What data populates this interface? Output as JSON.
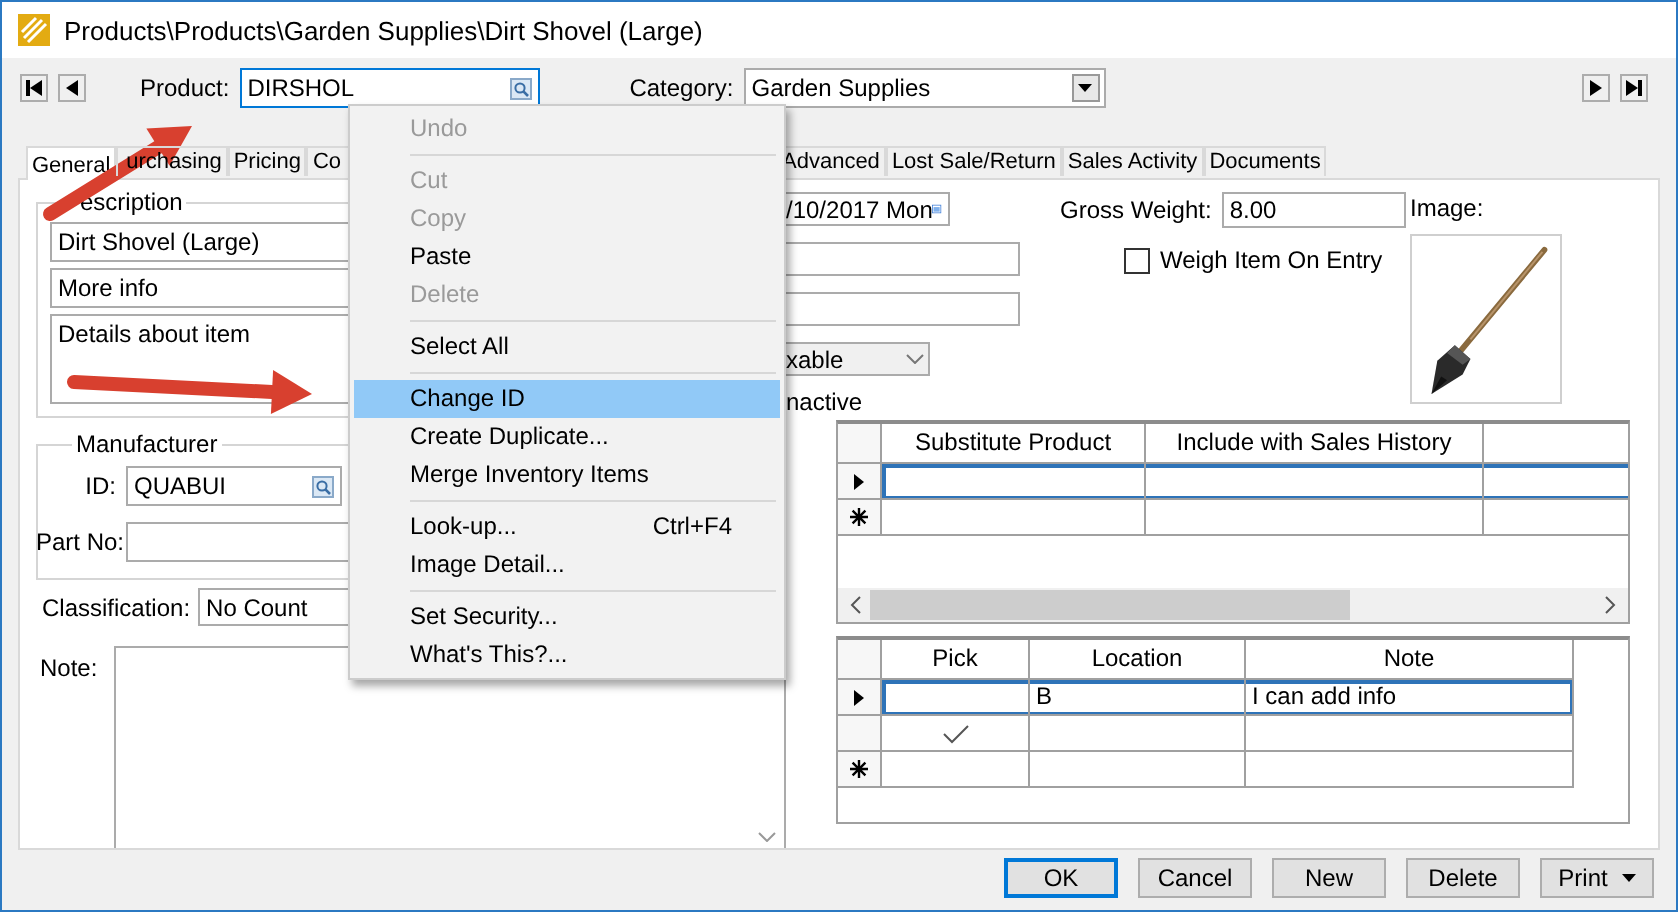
{
  "window": {
    "title": "Products\\Products\\Garden Supplies\\Dirt Shovel (Large)"
  },
  "header": {
    "product_label": "Product:",
    "product_value": "DIRSHOL",
    "category_label": "Category:",
    "category_value": "Garden Supplies"
  },
  "tabs": [
    {
      "label": "General",
      "selected": true
    },
    {
      "label": "urchasing",
      "selected": false
    },
    {
      "label": "Pricing",
      "selected": false
    },
    {
      "label": "Co",
      "selected": false
    },
    {
      "label": "Advanced",
      "selected": false
    },
    {
      "label": "Lost Sale/Return",
      "selected": false
    },
    {
      "label": "Sales Activity",
      "selected": false
    },
    {
      "label": "Documents",
      "selected": false
    }
  ],
  "general": {
    "description_legend": "escription",
    "description_lines": [
      "Dirt Shovel (Large)",
      "More info"
    ],
    "details": "Details about item",
    "manufacturer_legend": "Manufacturer",
    "id_label": "ID:",
    "id_value": "QUABUI",
    "part_no_label": "Part No:",
    "classification_label": "Classification:",
    "classification_value": "No Count",
    "note_label": "Note:",
    "date_value": "/10/2017 Mon",
    "tax_value": "xable",
    "inactive_label": "nactive",
    "gross_weight_label": "Gross Weight:",
    "gross_weight_value": "8.00",
    "weigh_item": {
      "label": "Weigh Item On Entry",
      "checked": false
    },
    "image_label": "Image:"
  },
  "substitutes_grid": {
    "columns": [
      "Substitute Product",
      "Include with Sales History"
    ],
    "rows": [
      {
        "kind": "current",
        "selected": true
      },
      {
        "kind": "new",
        "selected": false
      }
    ]
  },
  "locations_grid": {
    "columns": [
      "Pick",
      "Location",
      "Note"
    ],
    "rows": [
      {
        "kind": "current",
        "selected": true,
        "pick": false,
        "location": "B",
        "note": "I can add info"
      },
      {
        "kind": "record",
        "selected": false,
        "pick": true
      },
      {
        "kind": "new",
        "selected": false,
        "pick": false
      }
    ]
  },
  "context_menu": [
    {
      "kind": "item",
      "label": "Undo",
      "disabled": true,
      "selected": false
    },
    {
      "kind": "separator"
    },
    {
      "kind": "item",
      "label": "Cut",
      "disabled": true,
      "selected": false
    },
    {
      "kind": "item",
      "label": "Copy",
      "disabled": true,
      "selected": false
    },
    {
      "kind": "item",
      "label": "Paste",
      "disabled": false,
      "selected": false
    },
    {
      "kind": "item",
      "label": "Delete",
      "disabled": true,
      "selected": false
    },
    {
      "kind": "separator"
    },
    {
      "kind": "item",
      "label": "Select All",
      "disabled": false,
      "selected": false
    },
    {
      "kind": "separator"
    },
    {
      "kind": "item",
      "label": "Change ID",
      "disabled": false,
      "selected": true
    },
    {
      "kind": "item",
      "label": "Create Duplicate...",
      "disabled": false,
      "selected": false
    },
    {
      "kind": "item",
      "label": "Merge Inventory Items",
      "disabled": false,
      "selected": false
    },
    {
      "kind": "separator"
    },
    {
      "kind": "item",
      "label": "Look-up...",
      "shortcut": "Ctrl+F4",
      "disabled": false,
      "selected": false
    },
    {
      "kind": "item",
      "label": "Image Detail...",
      "disabled": false,
      "selected": false
    },
    {
      "kind": "separator"
    },
    {
      "kind": "item",
      "label": "Set Security...",
      "disabled": false,
      "selected": false
    },
    {
      "kind": "item",
      "label": "What's This?...",
      "disabled": false,
      "selected": false
    }
  ],
  "buttons": [
    {
      "label": "OK",
      "kind": "plain",
      "default": true
    },
    {
      "label": "Cancel",
      "kind": "plain",
      "default": false
    },
    {
      "label": "New",
      "kind": "plain",
      "default": false
    },
    {
      "label": "Delete",
      "kind": "plain",
      "default": false
    },
    {
      "label": "Print",
      "kind": "dropdown",
      "default": false
    }
  ]
}
